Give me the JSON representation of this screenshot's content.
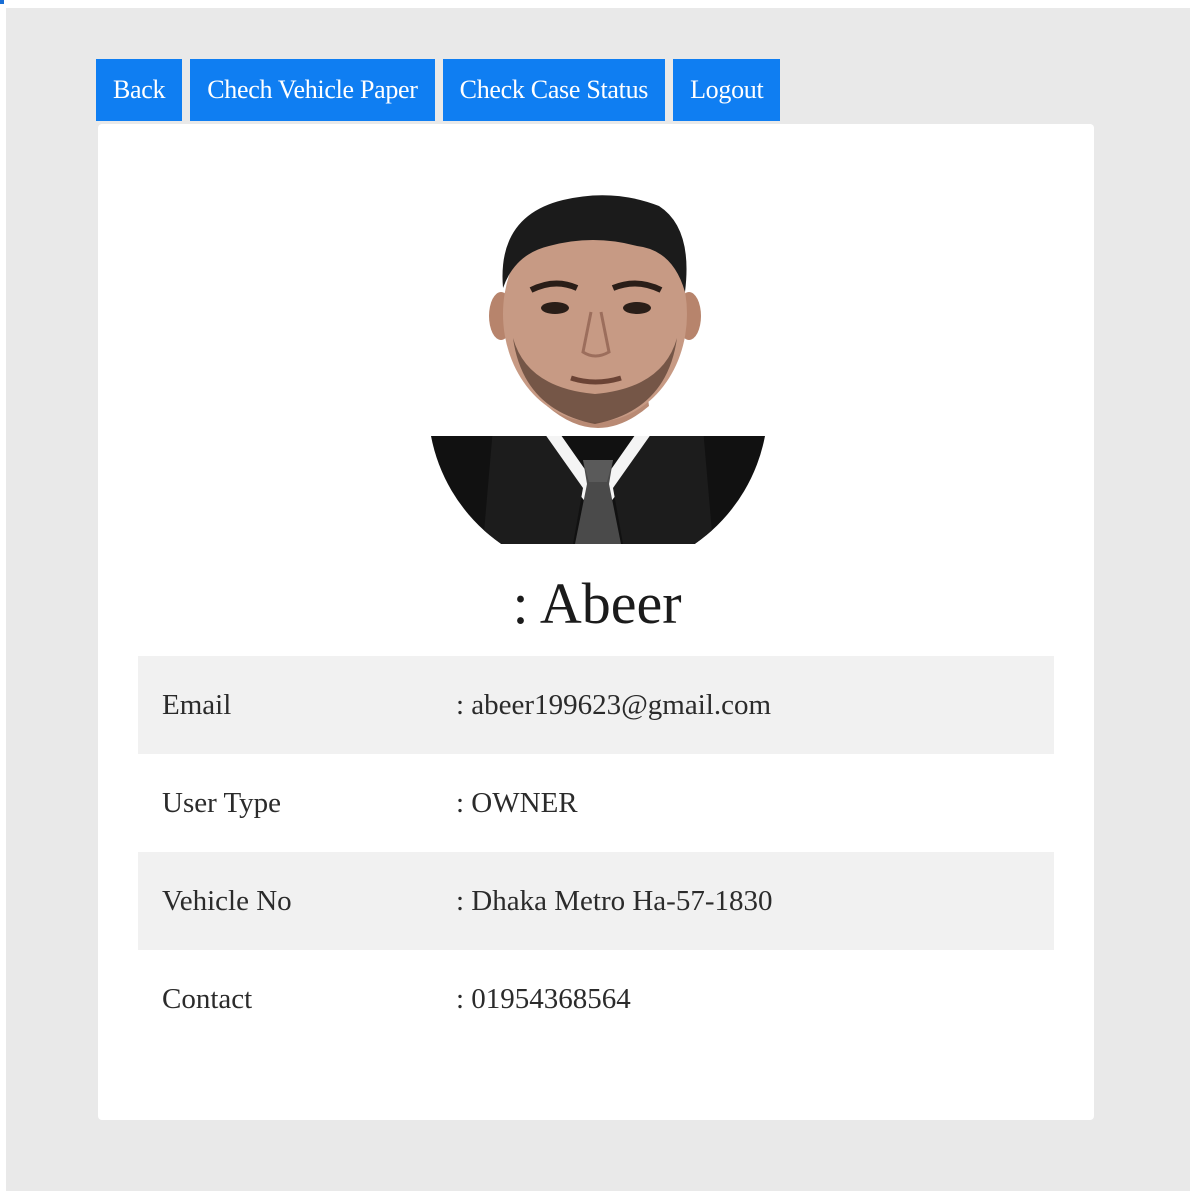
{
  "nav": {
    "items": [
      {
        "label": "Back"
      },
      {
        "label": "Chech Vehicle Paper"
      },
      {
        "label": "Check Case Status"
      },
      {
        "label": "Logout"
      }
    ]
  },
  "profile": {
    "name": ": Abeer",
    "rows": [
      {
        "label": "Email",
        "value": ": abeer199623@gmail.com"
      },
      {
        "label": "User Type",
        "value": ": OWNER"
      },
      {
        "label": "Vehicle No",
        "value": ": Dhaka Metro Ha-57-1830"
      },
      {
        "label": "Contact",
        "value": ": 01954368564"
      }
    ]
  },
  "colors": {
    "nav_button": "#0f7ef2",
    "page_background": "#e9e9e9",
    "card_background": "#ffffff",
    "striped_row": "#f1f1f1"
  }
}
